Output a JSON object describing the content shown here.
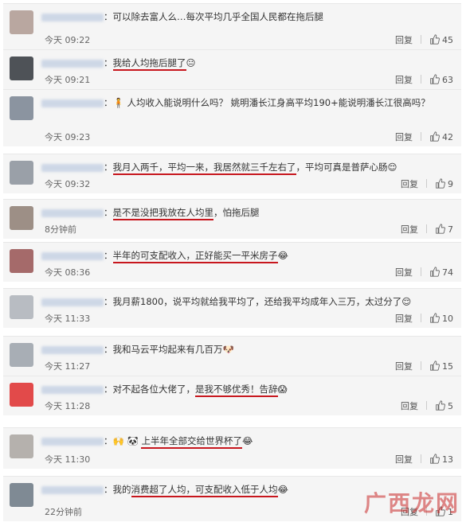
{
  "comments": [
    {
      "text_pre": "：可以除去富人么…每次平均几乎全国人民都在拖后腿",
      "text_u": "",
      "text_post": "",
      "emoji": "",
      "time": "今天 09:22",
      "reply": "回复",
      "likes": "45",
      "avatar_color": "#b9a7a0"
    },
    {
      "text_pre": "：",
      "text_u": "我给人均拖后腿了",
      "text_post": "",
      "emoji": "😐",
      "time": "今天 09:21",
      "reply": "回复",
      "likes": "63",
      "avatar_color": "#4e5257"
    },
    {
      "text_pre": "：🧍 人均收入能说明什么吗？ 姚明潘长江身高平均190+能说明潘长江很高吗？",
      "text_u": "",
      "text_post": "",
      "emoji": "",
      "time": "今天 09:23",
      "reply": "回复",
      "likes": "42",
      "avatar_color": "#8b94a0"
    },
    {
      "text_pre": "：",
      "text_u": "我月入两千，平均一来，我居然就三千左右了",
      "text_post": "，平均可真是普萨心肠",
      "emoji": "😌",
      "time": "今天 09:32",
      "reply": "回复",
      "likes": "9",
      "avatar_color": "#9aa0a8"
    },
    {
      "text_pre": "：",
      "text_u": "是不是没把我放在人均里",
      "text_post": "，怕拖后腿",
      "emoji": "",
      "time": "8分钟前",
      "reply": "回复",
      "likes": "7",
      "avatar_color": "#9d8f86"
    },
    {
      "text_pre": "：",
      "text_u": "半年的可支配收入，正好能买一平米房子",
      "text_post": "",
      "emoji": "😂",
      "time": "今天 08:36",
      "reply": "回复",
      "likes": "74",
      "avatar_color": "#a56a6a"
    },
    {
      "text_pre": "：我月薪1800，说平均就给我平均了，还给我平均成年入三万，太过分了",
      "text_u": "",
      "text_post": "",
      "emoji": "😌",
      "time": "今天 11:33",
      "reply": "回复",
      "likes": "10",
      "avatar_color": "#b8bcc2"
    },
    {
      "text_pre": "：我和马云平均起来有几百万",
      "text_u": "",
      "text_post": "",
      "emoji": "🐶",
      "time": "今天 11:27",
      "reply": "回复",
      "likes": "15",
      "avatar_color": "#a8aeb5"
    },
    {
      "text_pre": "：对不起各位大佬了，",
      "text_u": "是我不够优秀！告辞",
      "text_post": "",
      "emoji": "😱",
      "time": "今天 11:28",
      "reply": "回复",
      "likes": "5",
      "avatar_color": "#e24a4a"
    },
    {
      "text_pre": "：🙌 🐼 ",
      "text_u": "上半年全部交给世界杯了",
      "text_post": "",
      "emoji": "😂",
      "time": "今天 11:30",
      "reply": "回复",
      "likes": "13",
      "avatar_color": "#b5b1ad"
    },
    {
      "text_pre": "：我的",
      "text_u": "消费超了人均，可支配收入低于人均",
      "text_post": "",
      "emoji": "😂",
      "time": "22分钟前",
      "reply": "回复",
      "likes": "1",
      "avatar_color": "#7f8a94"
    }
  ],
  "watermark": "广西龙网"
}
